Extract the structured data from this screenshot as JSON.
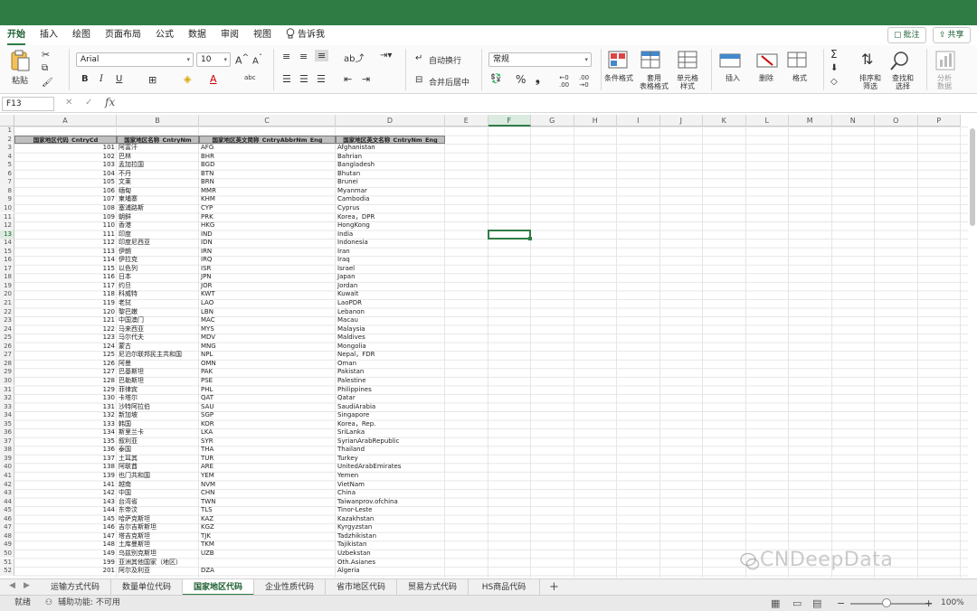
{
  "ribbon_tabs": [
    "开始",
    "插入",
    "绘图",
    "页面布局",
    "公式",
    "数据",
    "审阅",
    "视图",
    "告诉我"
  ],
  "top_buttons": {
    "comment": "批注",
    "share": "共享"
  },
  "ribbon": {
    "paste": "粘贴",
    "font_name": "Arial",
    "font_size": "10",
    "bold": "B",
    "italic": "I",
    "underline": "U",
    "wrap_text": "自动换行",
    "merge_center": "合并后居中",
    "number_format": "常规",
    "percent": "%",
    "comma": "❟",
    "cond_format": "条件格式",
    "table_format": [
      "套用",
      "表格格式"
    ],
    "cell_style": [
      "单元格",
      "样式"
    ],
    "insert": "插入",
    "delete": "删除",
    "format": "格式",
    "sort_filter": [
      "排序和",
      "筛选"
    ],
    "find_select": [
      "查找和",
      "选择"
    ],
    "analyze": [
      "分析",
      "数据"
    ],
    "sum": "Σ"
  },
  "formula_bar": {
    "name_box": "F13",
    "fx": "fx",
    "value": ""
  },
  "columns": [
    "A",
    "B",
    "C",
    "D",
    "E",
    "F",
    "G",
    "H",
    "I",
    "J",
    "K",
    "L",
    "M",
    "N",
    "O",
    "P"
  ],
  "active_cell": {
    "col": "F",
    "row": 13
  },
  "headers": [
    "国家地区代码_CntryCd",
    "国家地区名称_CntryNm",
    "国家地区英文简称_CntryAbbrNm_Eng",
    "国家地区英文名称_CntryNm_Eng"
  ],
  "rows": [
    [
      "101",
      "阿富汗",
      "AFG",
      "Afghanistan"
    ],
    [
      "102",
      "巴林",
      "BHR",
      "Bahrian"
    ],
    [
      "103",
      "孟加拉国",
      "BGD",
      "Bangladesh"
    ],
    [
      "104",
      "不丹",
      "BTN",
      "Bhutan"
    ],
    [
      "105",
      "文莱",
      "BRN",
      "Brunei"
    ],
    [
      "106",
      "缅甸",
      "MMR",
      "Myanmar"
    ],
    [
      "107",
      "柬埔寨",
      "KHM",
      "Cambodia"
    ],
    [
      "108",
      "塞浦路斯",
      "CYP",
      "Cyprus"
    ],
    [
      "109",
      "朝鲜",
      "PRK",
      "Korea，DPR"
    ],
    [
      "110",
      "香港",
      "HKG",
      "HongKong"
    ],
    [
      "111",
      "印度",
      "IND",
      "India"
    ],
    [
      "112",
      "印度尼西亚",
      "IDN",
      "Indonesia"
    ],
    [
      "113",
      "伊朗",
      "IRN",
      "Iran"
    ],
    [
      "114",
      "伊拉克",
      "IRQ",
      "Iraq"
    ],
    [
      "115",
      "以色列",
      "ISR",
      "Israel"
    ],
    [
      "116",
      "日本",
      "JPN",
      "Japan"
    ],
    [
      "117",
      "约旦",
      "JOR",
      "Jordan"
    ],
    [
      "118",
      "科威特",
      "KWT",
      "Kuwait"
    ],
    [
      "119",
      "老挝",
      "LAO",
      "LaoPDR"
    ],
    [
      "120",
      "黎巴嫩",
      "LBN",
      "Lebanon"
    ],
    [
      "121",
      "中国澳门",
      "MAC",
      "Macau"
    ],
    [
      "122",
      "马来西亚",
      "MYS",
      "Malaysia"
    ],
    [
      "123",
      "马尔代夫",
      "MDV",
      "Maldives"
    ],
    [
      "124",
      "蒙古",
      "MNG",
      "Mongolia"
    ],
    [
      "125",
      "尼泊尔联邦民主共和国",
      "NPL",
      "Nepal，FDR"
    ],
    [
      "126",
      "阿曼",
      "OMN",
      "Oman"
    ],
    [
      "127",
      "巴基斯坦",
      "PAK",
      "Pakistan"
    ],
    [
      "128",
      "巴勒斯坦",
      "PSE",
      "Palestine"
    ],
    [
      "129",
      "菲律宾",
      "PHL",
      "Philippines"
    ],
    [
      "130",
      "卡塔尔",
      "QAT",
      "Qatar"
    ],
    [
      "131",
      "沙特阿拉伯",
      "SAU",
      "SaudiArabia"
    ],
    [
      "132",
      "新加坡",
      "SGP",
      "Singapore"
    ],
    [
      "133",
      "韩国",
      "KOR",
      "Korea，Rep."
    ],
    [
      "134",
      "斯里兰卡",
      "LKA",
      "SriLanka"
    ],
    [
      "135",
      "叙利亚",
      "SYR",
      "SyrianArabRepublic"
    ],
    [
      "136",
      "泰国",
      "THA",
      "Thailand"
    ],
    [
      "137",
      "土耳其",
      "TUR",
      "Turkey"
    ],
    [
      "138",
      "阿联酋",
      "ARE",
      "UnitedArabEmirates"
    ],
    [
      "139",
      "也门共和国",
      "YEM",
      "Yemen"
    ],
    [
      "141",
      "越南",
      "NVM",
      "VietNam"
    ],
    [
      "142",
      "中国",
      "CHN",
      "China"
    ],
    [
      "143",
      "台湾省",
      "TWN",
      "Taiwanprov.ofchina"
    ],
    [
      "144",
      "东帝汶",
      "TLS",
      "Tinor-Leste"
    ],
    [
      "145",
      "哈萨克斯坦",
      "KAZ",
      "Kazakhstan"
    ],
    [
      "146",
      "吉尔吉斯斯坦",
      "KGZ",
      "Kyrgyzstan"
    ],
    [
      "147",
      "塔吉克斯坦",
      "TJK",
      "Tadzhikistan"
    ],
    [
      "148",
      "土库曼斯坦",
      "TKM",
      "Tajikistan"
    ],
    [
      "149",
      "乌兹别克斯坦",
      "UZB",
      "Uzbekstan"
    ],
    [
      "199",
      "亚洲其他国家（地区）",
      "",
      "Oth.Asianes"
    ],
    [
      "201",
      "阿尔及利亚",
      "DZA",
      "Algeria"
    ]
  ],
  "sheet_tabs": [
    "运输方式代码",
    "数量单位代码",
    "国家地区代码",
    "企业性质代码",
    "省市地区代码",
    "贸易方式代码",
    "HS商品代码"
  ],
  "active_sheet": "国家地区代码",
  "status": {
    "ready": "就绪",
    "accessibility": "辅助功能: 不可用",
    "zoom": "100%"
  },
  "watermark": "CNDeepData"
}
